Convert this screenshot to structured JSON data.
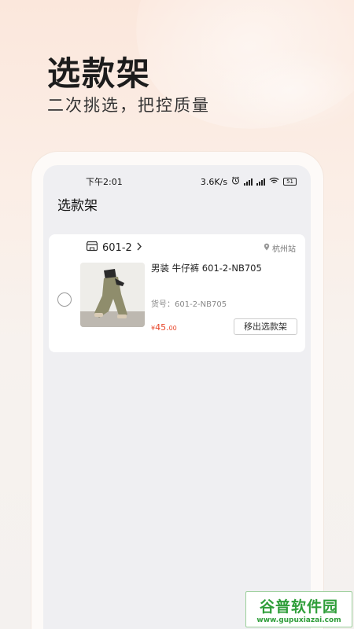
{
  "hero": {
    "title": "选款架",
    "subtitle": "二次挑选，把控质量"
  },
  "statusbar": {
    "time": "下午2:01",
    "network_speed": "3.6K/s",
    "battery": "51"
  },
  "page": {
    "title": "选款架"
  },
  "card": {
    "shop_name": "601-2",
    "location": "杭州站",
    "product_name": "男装 牛仔裤 601-2-NB705",
    "product_code": "货号：601-2-NB705",
    "price_symbol": "¥",
    "price_main": "45.",
    "price_decimal": "00",
    "remove_label": "移出选款架"
  },
  "watermark": {
    "top": "谷普软件园",
    "bottom": "www.gupuxiazai.com"
  },
  "colors": {
    "price": "#e8472b",
    "watermark": "#2f9e3a"
  }
}
